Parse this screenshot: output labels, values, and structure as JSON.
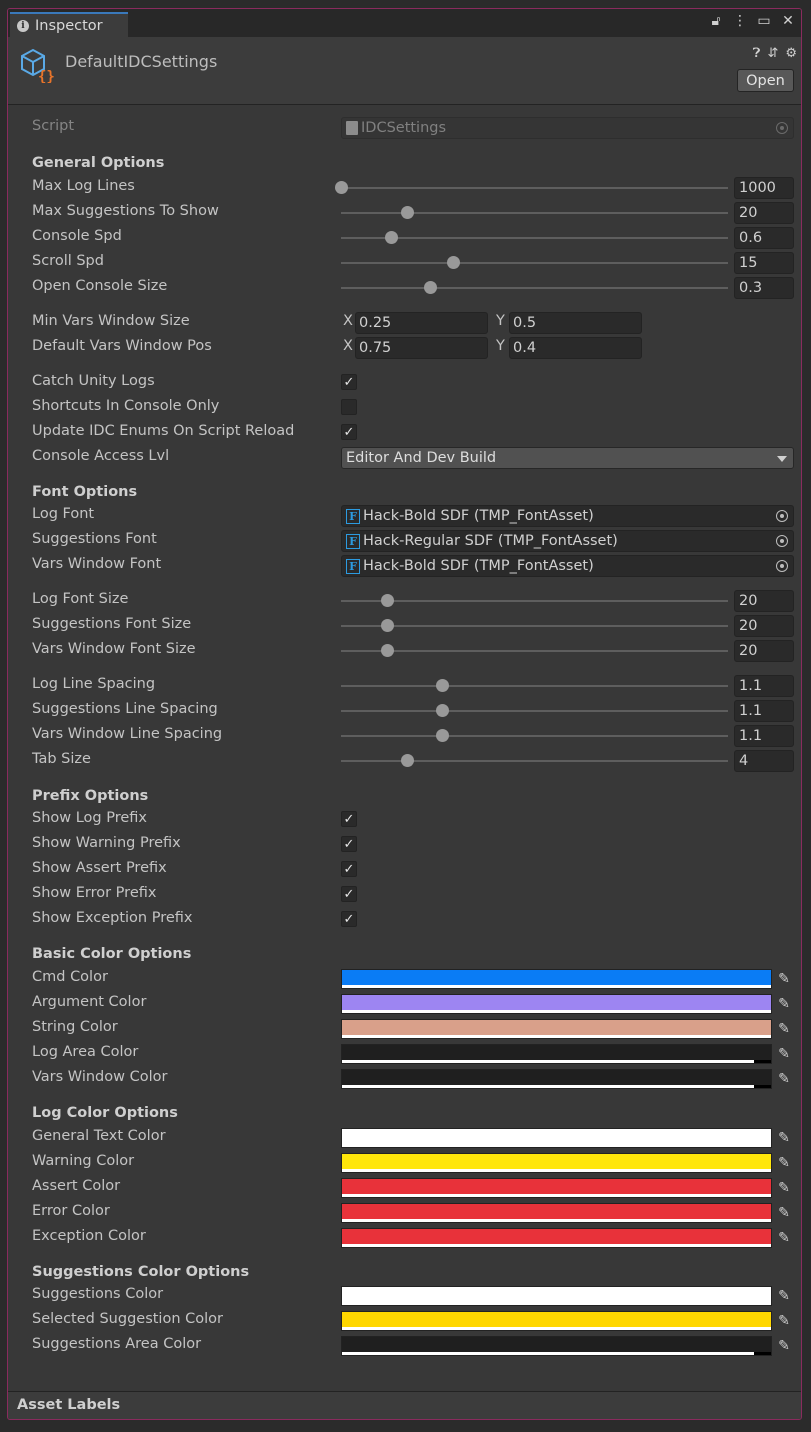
{
  "window": {
    "tab_label": "Inspector",
    "asset_title": "DefaultIDCSettings",
    "open_label": "Open",
    "footer_label": "Asset Labels"
  },
  "script_field": {
    "label": "Script",
    "value": "IDCSettings"
  },
  "sections": {
    "general": "General Options",
    "font": "Font Options",
    "prefix": "Prefix Options",
    "basic_color": "Basic Color Options",
    "log_color": "Log Color Options",
    "suggest_color": "Suggestions Color Options"
  },
  "general_sliders": [
    {
      "label": "Max Log Lines",
      "value": "1000",
      "fill": 0.0
    },
    {
      "label": "Max Suggestions To Show",
      "value": "20",
      "fill": 0.17
    },
    {
      "label": "Console Spd",
      "value": "0.6",
      "fill": 0.13
    },
    {
      "label": "Scroll Spd",
      "value": "15",
      "fill": 0.29
    },
    {
      "label": "Open Console Size",
      "value": "0.3",
      "fill": 0.23
    }
  ],
  "vectors": [
    {
      "label": "Min Vars Window Size",
      "x": "0.25",
      "y": "0.5"
    },
    {
      "label": "Default Vars Window Pos",
      "x": "0.75",
      "y": "0.4"
    }
  ],
  "vec_x": "X",
  "vec_y": "Y",
  "general_toggles": [
    {
      "label": "Catch Unity Logs",
      "checked": true,
      "mark": "✓"
    },
    {
      "label": "Shortcuts In Console Only",
      "checked": false,
      "mark": ""
    },
    {
      "label": "Update IDC Enums On Script Reload",
      "checked": true,
      "mark": "✓"
    }
  ],
  "access": {
    "label": "Console Access Lvl",
    "value": "Editor And Dev Build"
  },
  "font_assets": [
    {
      "label": "Log Font",
      "value": "Hack-Bold SDF (TMP_FontAsset)"
    },
    {
      "label": "Suggestions Font",
      "value": "Hack-Regular SDF (TMP_FontAsset)"
    },
    {
      "label": "Vars Window Font",
      "value": "Hack-Bold SDF (TMP_FontAsset)"
    }
  ],
  "font_size_sliders": [
    {
      "label": "Log Font Size",
      "value": "20",
      "fill": 0.12
    },
    {
      "label": "Suggestions Font Size",
      "value": "20",
      "fill": 0.12
    },
    {
      "label": "Vars Window Font Size",
      "value": "20",
      "fill": 0.12
    }
  ],
  "spacing_sliders": [
    {
      "label": "Log Line Spacing",
      "value": "1.1",
      "fill": 0.26
    },
    {
      "label": "Suggestions Line Spacing",
      "value": "1.1",
      "fill": 0.26
    },
    {
      "label": "Vars Window Line Spacing",
      "value": "1.1",
      "fill": 0.26
    },
    {
      "label": "Tab Size",
      "value": "4",
      "fill": 0.17
    }
  ],
  "prefix_toggles": [
    {
      "label": "Show Log Prefix",
      "checked": true,
      "mark": "✓"
    },
    {
      "label": "Show Warning Prefix",
      "checked": true,
      "mark": "✓"
    },
    {
      "label": "Show Assert Prefix",
      "checked": true,
      "mark": "✓"
    },
    {
      "label": "Show Error Prefix",
      "checked": true,
      "mark": "✓"
    },
    {
      "label": "Show Exception Prefix",
      "checked": true,
      "mark": "✓"
    }
  ],
  "basic_colors": [
    {
      "label": "Cmd Color",
      "color": "#0a7cf5",
      "alpha": 1.0
    },
    {
      "label": "Argument Color",
      "color": "#9d85f2",
      "alpha": 1.0
    },
    {
      "label": "String Color",
      "color": "#d9a08a",
      "alpha": 1.0
    },
    {
      "label": "Log Area Color",
      "color": "#1f1f1f",
      "alpha": 0.96
    },
    {
      "label": "Vars Window Color",
      "color": "#1f1f1f",
      "alpha": 0.96
    }
  ],
  "log_colors": [
    {
      "label": "General Text Color",
      "color": "#ffffff",
      "alpha": 1.0
    },
    {
      "label": "Warning Color",
      "color": "#ffe60a",
      "alpha": 1.0
    },
    {
      "label": "Assert Color",
      "color": "#e8323a",
      "alpha": 1.0
    },
    {
      "label": "Error Color",
      "color": "#e8323a",
      "alpha": 1.0
    },
    {
      "label": "Exception Color",
      "color": "#e8323a",
      "alpha": 1.0
    }
  ],
  "suggest_colors": [
    {
      "label": "Suggestions Color",
      "color": "#ffffff",
      "alpha": 1.0
    },
    {
      "label": "Selected Suggestion Color",
      "color": "#ffd700",
      "alpha": 1.0
    },
    {
      "label": "Suggestions Area Color",
      "color": "#1f1f1f",
      "alpha": 0.96
    }
  ],
  "icons": {
    "tab": "info-icon",
    "lock": "lock-icon",
    "menu": "kebab-menu-icon",
    "maximize": "maximize-icon",
    "close": "close-icon",
    "help": "help-icon",
    "preset": "preset-icon",
    "settings": "gear-icon",
    "picker": "eyedropper-icon"
  }
}
